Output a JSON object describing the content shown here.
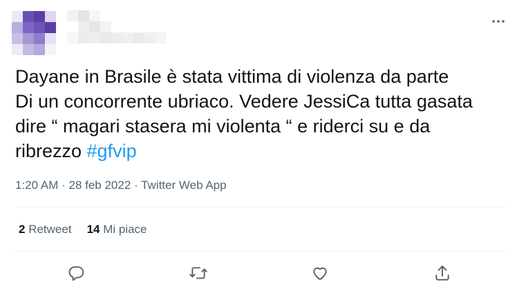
{
  "tweet": {
    "text_lines": "Dayane in Brasile è stata vittima di violenza da parte\nDi un concorrente ubriaco. Vedere JessiCa tutta gasata\ndire “ magari stasera mi violenta “ e riderci su e da\nribrezzo ",
    "hashtag": "#gfvip",
    "time": "1:20 AM",
    "separator": " · ",
    "date": "28 feb 2022",
    "source": "Twitter Web App"
  },
  "stats": {
    "retweets_count": "2",
    "retweets_label": " Retweet",
    "likes_count": "14",
    "likes_label": " Mi piace"
  },
  "colors": {
    "text": "#0f1419",
    "muted": "#536471",
    "link": "#1d9bf0",
    "divider": "#eff3f4",
    "avatar_dark": "#5b3fa8",
    "avatar_light": "#b9aee0"
  },
  "icons": {
    "more": "more-horizontal-icon",
    "reply": "reply-bubble-icon",
    "retweet": "retweet-arrows-icon",
    "like": "heart-icon",
    "share": "share-upload-icon"
  }
}
